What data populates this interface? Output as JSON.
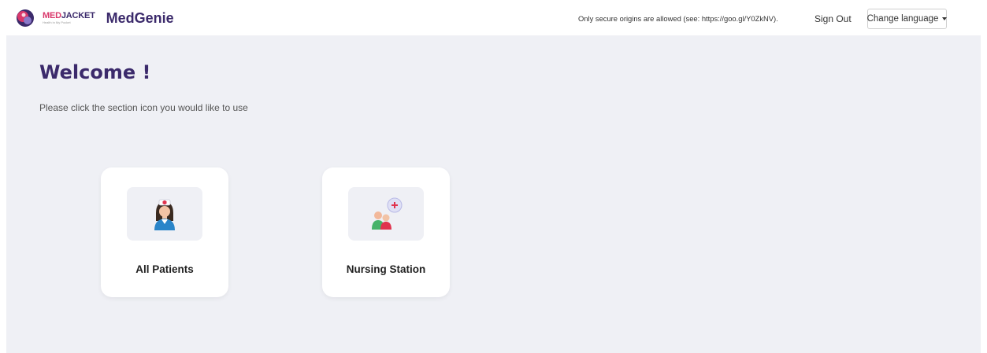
{
  "header": {
    "brand_med": "MED",
    "brand_jacket": "JACKET",
    "brand_tagline": "Health in My Pocket",
    "app_name": "MedGenie",
    "notice": "Only secure origins are allowed (see: https://goo.gl/Y0ZkNV).",
    "sign_out": "Sign Out",
    "change_language": "Change language"
  },
  "main": {
    "title": "Welcome !",
    "subtitle": "Please click the section icon you would like to use",
    "cards": [
      {
        "label": "All Patients",
        "icon": "nurse-icon"
      },
      {
        "label": "Nursing Station",
        "icon": "nursing-group-icon"
      }
    ]
  },
  "colors": {
    "brand_purple": "#3b2a6b",
    "brand_pink": "#d9386b",
    "background": "#eff0f5"
  }
}
